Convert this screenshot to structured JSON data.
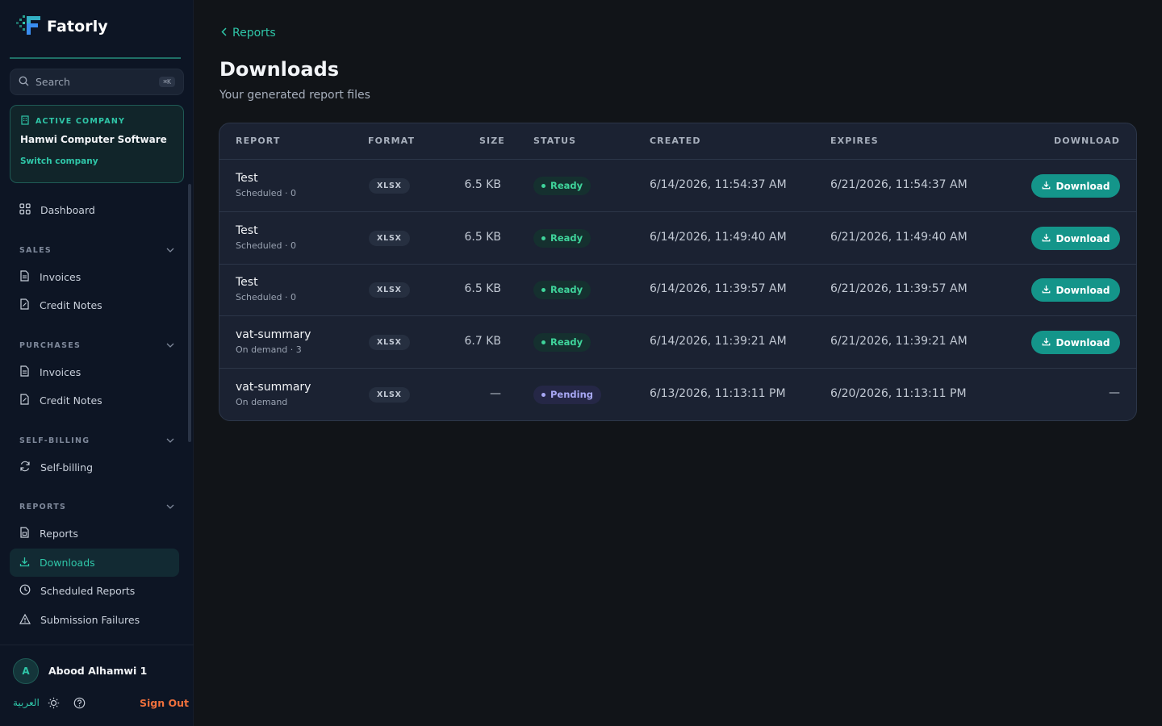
{
  "brand": {
    "name": "Fatorly"
  },
  "search": {
    "placeholder": "Search",
    "shortcut": "⌘K"
  },
  "company": {
    "tag": "ACTIVE COMPANY",
    "name": "Hamwi Computer Software",
    "switch_label": "Switch company"
  },
  "nav": {
    "dashboard": "Dashboard",
    "sections": {
      "sales": {
        "title": "SALES",
        "items": [
          "Invoices",
          "Credit Notes"
        ]
      },
      "purchases": {
        "title": "PURCHASES",
        "items": [
          "Invoices",
          "Credit Notes"
        ]
      },
      "self_billing": {
        "title": "SELF-BILLING",
        "items": [
          "Self-billing"
        ]
      },
      "reports": {
        "title": "REPORTS",
        "items": [
          "Reports",
          "Downloads",
          "Scheduled Reports",
          "Submission Failures"
        ]
      }
    },
    "active": "Downloads"
  },
  "user": {
    "initial": "A",
    "name": "Abood Alhamwi 1",
    "language": "العربية",
    "signout": "Sign Out"
  },
  "header": {
    "back_label": "Reports",
    "title": "Downloads",
    "subtitle": "Your generated report files"
  },
  "table": {
    "columns": [
      "REPORT",
      "FORMAT",
      "SIZE",
      "STATUS",
      "CREATED",
      "EXPIRES",
      "DOWNLOAD"
    ],
    "rows": [
      {
        "name": "Test",
        "meta": "Scheduled · 0",
        "format": "XLSX",
        "size": "6.5 KB",
        "status": "Ready",
        "created": "6/14/2026, 11:54:37 AM",
        "expires": "6/21/2026, 11:54:37 AM",
        "download": "Download"
      },
      {
        "name": "Test",
        "meta": "Scheduled · 0",
        "format": "XLSX",
        "size": "6.5 KB",
        "status": "Ready",
        "created": "6/14/2026, 11:49:40 AM",
        "expires": "6/21/2026, 11:49:40 AM",
        "download": "Download"
      },
      {
        "name": "Test",
        "meta": "Scheduled · 0",
        "format": "XLSX",
        "size": "6.5 KB",
        "status": "Ready",
        "created": "6/14/2026, 11:39:57 AM",
        "expires": "6/21/2026, 11:39:57 AM",
        "download": "Download"
      },
      {
        "name": "vat-summary",
        "meta": "On demand · 3",
        "format": "XLSX",
        "size": "6.7 KB",
        "status": "Ready",
        "created": "6/14/2026, 11:39:21 AM",
        "expires": "6/21/2026, 11:39:21 AM",
        "download": "Download"
      },
      {
        "name": "vat-summary",
        "meta": "On demand",
        "format": "XLSX",
        "size": "—",
        "status": "Pending",
        "created": "6/13/2026, 11:13:11 PM",
        "expires": "6/20/2026, 11:13:11 PM",
        "download": "—"
      }
    ]
  },
  "colors": {
    "accent": "#2fc6a8",
    "button": "#14958a",
    "signout": "#f0703c",
    "ready": "#3fd49b",
    "pending": "#a8a8f5"
  }
}
